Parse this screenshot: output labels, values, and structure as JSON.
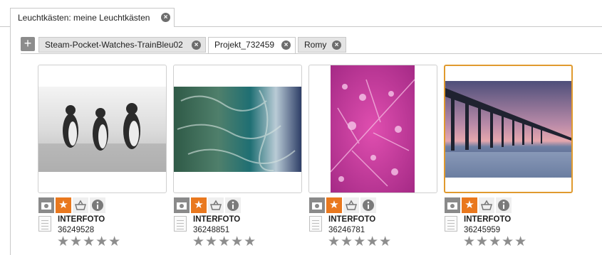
{
  "top_tab": {
    "label": "Leuchtkästen: meine Leuchtkästen",
    "close": "×"
  },
  "subtabs": {
    "add_label": "+",
    "items": [
      {
        "label": "Steam-Pocket-Watches-TrainBleu02",
        "close": "×"
      },
      {
        "label": "Projekt_732459",
        "close": "×",
        "active": true
      },
      {
        "label": "Romy",
        "close": "×"
      }
    ]
  },
  "accent_color": "#e9781e",
  "selected_border_color": "#e09a2e",
  "cards": [
    {
      "supplier": "INTERFOTO",
      "image_id": "36249528",
      "stars": "★★★★★",
      "fav": "★"
    },
    {
      "supplier": "INTERFOTO",
      "image_id": "36248851",
      "stars": "★★★★★",
      "fav": "★"
    },
    {
      "supplier": "INTERFOTO",
      "image_id": "36246781",
      "stars": "★★★★★",
      "fav": "★"
    },
    {
      "supplier": "INTERFOTO",
      "image_id": "36245959",
      "stars": "★★★★★",
      "fav": "★"
    }
  ]
}
